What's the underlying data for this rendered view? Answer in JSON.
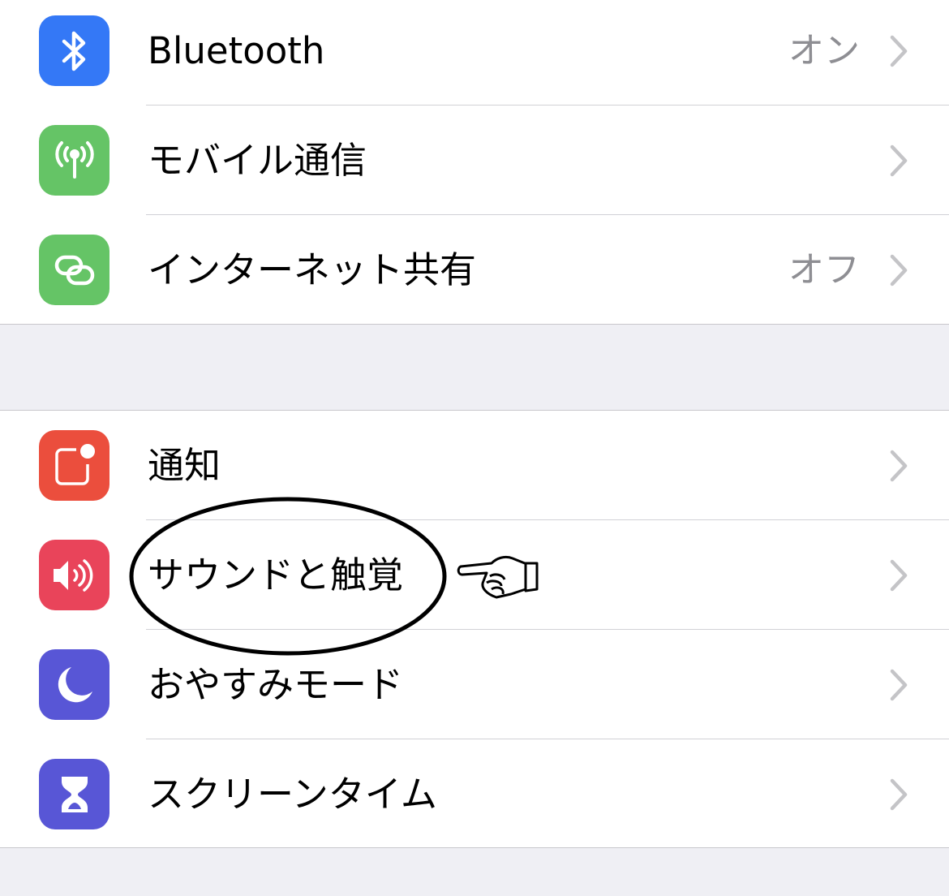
{
  "sections": [
    {
      "rows": [
        {
          "label": "Bluetooth",
          "value": "オン",
          "icon": "bluetooth-icon",
          "color": "#3478f6"
        },
        {
          "label": "モバイル通信",
          "value": "",
          "icon": "antenna-icon",
          "color": "#65c466"
        },
        {
          "label": "インターネット共有",
          "value": "オフ",
          "icon": "link-icon",
          "color": "#65c466"
        }
      ]
    },
    {
      "rows": [
        {
          "label": "通知",
          "value": "",
          "icon": "notification-icon",
          "color": "#eb4e3d"
        },
        {
          "label": "サウンドと触覚",
          "value": "",
          "icon": "speaker-icon",
          "color": "#e9445a"
        },
        {
          "label": "おやすみモード",
          "value": "",
          "icon": "moon-icon",
          "color": "#5856d6"
        },
        {
          "label": "スクリーンタイム",
          "value": "",
          "icon": "hourglass-icon",
          "color": "#5856d6"
        }
      ]
    }
  ],
  "annotation": {
    "highlighted": "サウンドと触覚",
    "marks": [
      "ellipse-circle",
      "pointing-hand-icon"
    ]
  }
}
